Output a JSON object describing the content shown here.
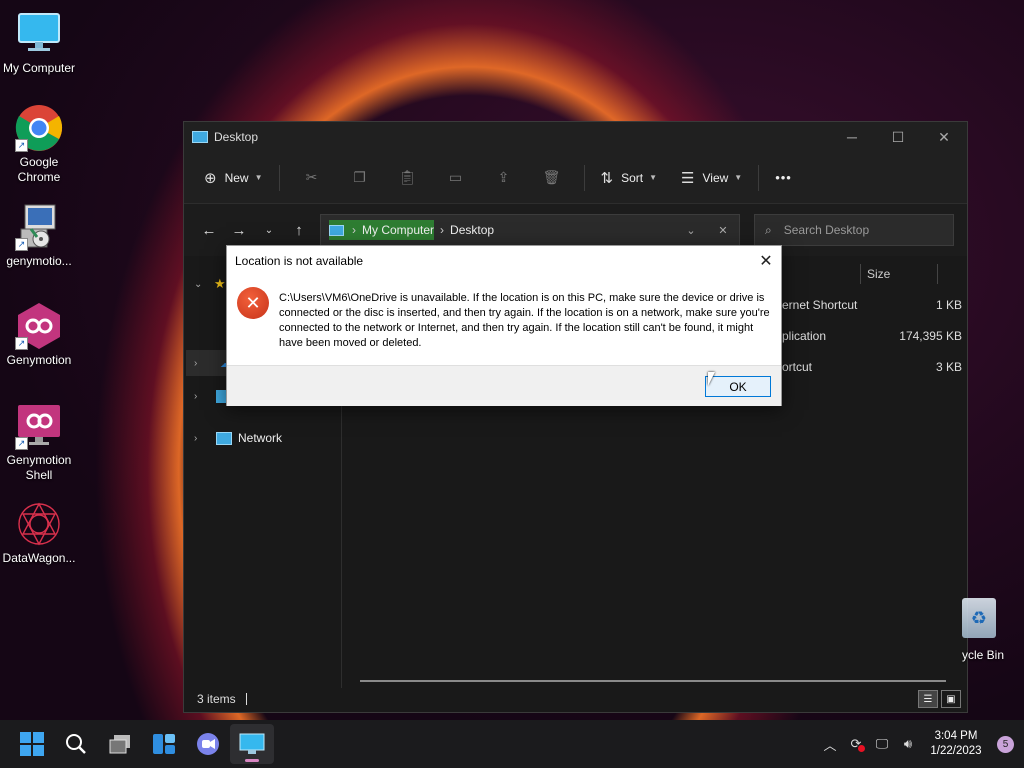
{
  "desktop": {
    "icons": [
      {
        "label": "My Computer",
        "icon": "monitor-icon"
      },
      {
        "label": "Google Chrome",
        "icon": "chrome-icon"
      },
      {
        "label": "genymotio...",
        "icon": "installer-icon"
      },
      {
        "label": "Genymotion",
        "icon": "genymotion-icon"
      },
      {
        "label": "Genymotion Shell",
        "icon": "genymotion-shell-icon"
      },
      {
        "label": "DataWagon...",
        "icon": "datawagon-icon"
      }
    ],
    "recycle_bin_label": "ycle Bin"
  },
  "explorer": {
    "title": "Desktop",
    "window_controls": {
      "minimize": "─",
      "maximize": "☐",
      "close": "✕"
    },
    "toolbar": {
      "new_label": "New",
      "sort_label": "Sort",
      "view_label": "View",
      "more_label": "•••"
    },
    "address": {
      "root": "My Computer",
      "current": "Desktop",
      "separator": "›"
    },
    "search_placeholder": "Search Desktop",
    "columns": {
      "type_partial": "e",
      "size": "Size"
    },
    "rows": [
      {
        "type": "ernet Shortcut",
        "size": "1 KB"
      },
      {
        "type": "plication",
        "size": "174,395 KB"
      },
      {
        "type": "ortcut",
        "size": "3 KB"
      }
    ],
    "sidebar": {
      "network_label": "Network"
    },
    "status": {
      "items": "3 items"
    }
  },
  "dialog": {
    "title": "Location is not available",
    "message": "C:\\Users\\VM6\\OneDrive is unavailable. If the location is on this PC, make sure the device or drive is connected or the disc is inserted, and then try again. If the location is on a network, make sure you're connected to the network or Internet, and then try again. If the location still can't be found, it might have been moved or deleted.",
    "ok_label": "OK",
    "close_glyph": "✕",
    "error_glyph": "✕"
  },
  "taskbar": {
    "time": "3:04 PM",
    "date": "1/22/2023",
    "notification_count": "5"
  },
  "colors": {
    "accent": "#0078d7",
    "error": "#d9401f",
    "explorer_bg": "#191919",
    "taskbar_bg": "#1b1b1d"
  }
}
